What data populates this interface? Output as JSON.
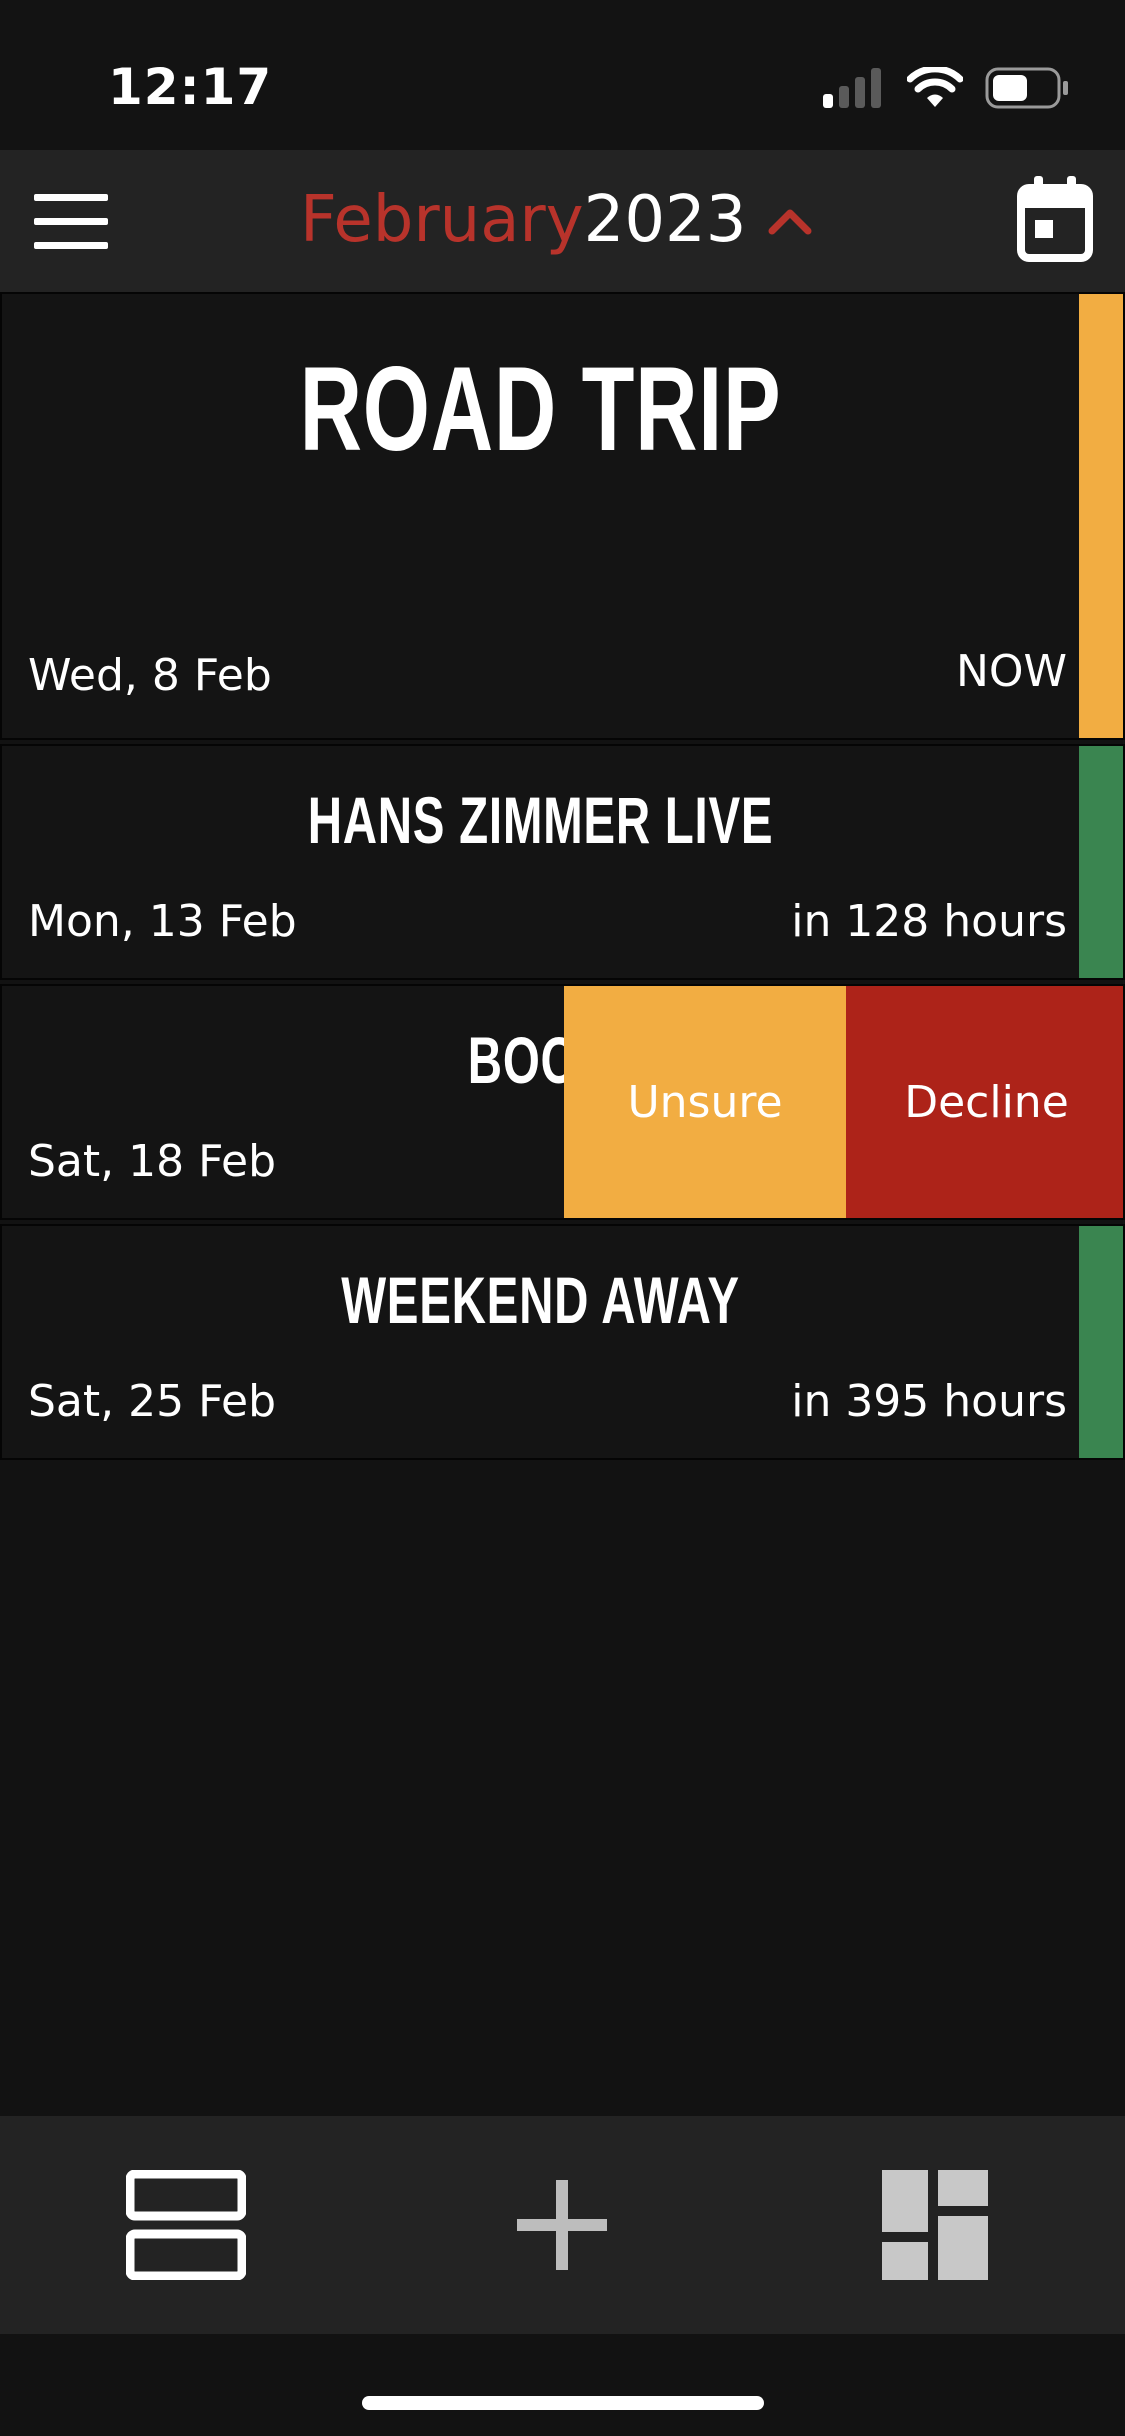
{
  "status_bar": {
    "time": "12:17",
    "icons": [
      "signal-icon",
      "wifi-icon",
      "battery-icon"
    ]
  },
  "header": {
    "month": "February",
    "year": "2023",
    "icons": [
      "menu-icon",
      "chevron-up-icon",
      "calendar-icon"
    ]
  },
  "colors": {
    "background": "#121212",
    "header_bg": "#232323",
    "month_red": "#b8332b",
    "accent_orange": "#f2ad42",
    "accent_green": "#3a8550",
    "decline_red": "#ad2319"
  },
  "events": [
    {
      "title": "ROAD TRIP",
      "date": "Wed, 8 Feb",
      "eta": "NOW",
      "accent": "#f2ad42"
    },
    {
      "title": "HANS ZIMMER LIVE",
      "date": "Mon, 13 Feb",
      "eta": "in 128 hours",
      "accent": "#3a8550"
    },
    {
      "title": "BOOK",
      "date": "Sat, 18 Feb",
      "eta": "",
      "accent": ""
    },
    {
      "title": "WEEKEND AWAY",
      "date": "Sat, 25 Feb",
      "eta": "in 395 hours",
      "accent": "#3a8550"
    }
  ],
  "swipe_actions": {
    "unsure": "Unsure",
    "decline": "Decline"
  },
  "tabbar": {
    "icons": [
      "list-view-icon",
      "add-icon",
      "dashboard-icon"
    ]
  }
}
